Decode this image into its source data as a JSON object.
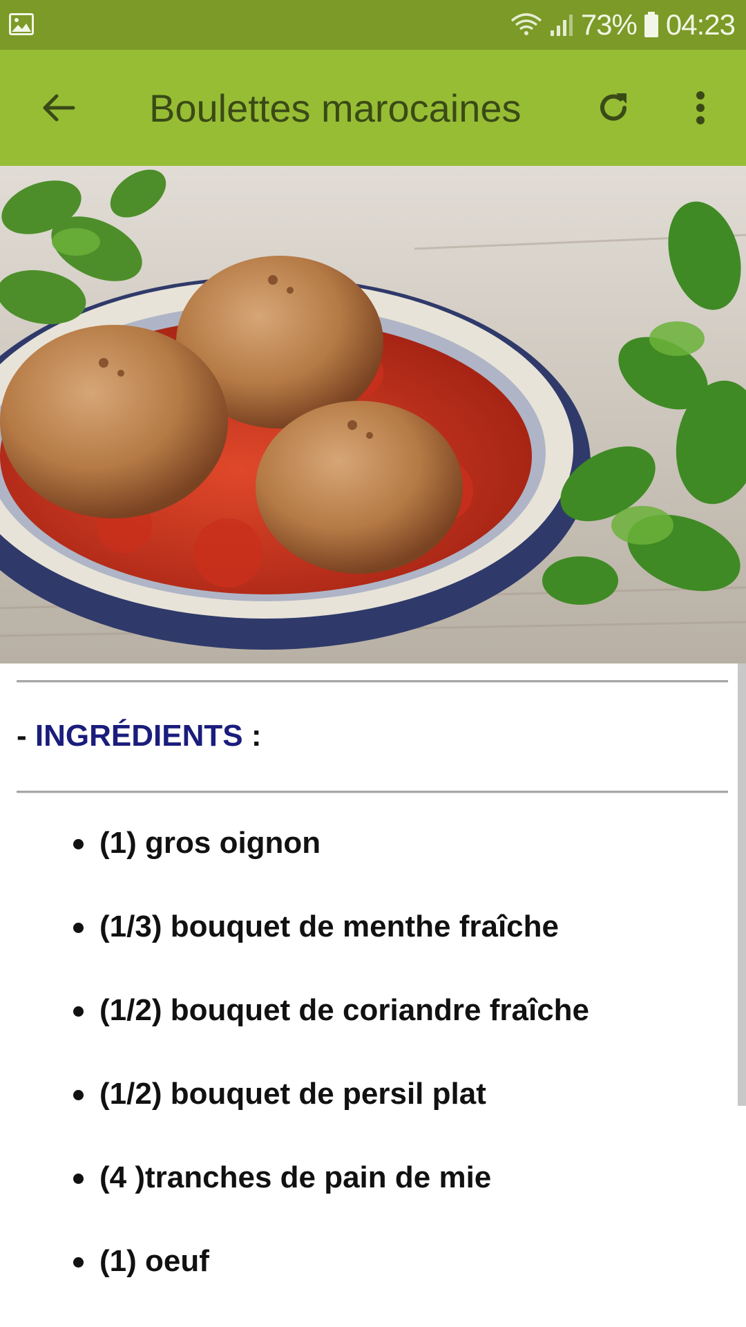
{
  "status_bar": {
    "battery_percent": "73%",
    "time": "04:23",
    "icons": [
      "gallery-icon",
      "wifi-icon",
      "signal-icon",
      "battery-icon"
    ]
  },
  "app_bar": {
    "title": "Boulettes marocaines",
    "icons": [
      "back-arrow-icon",
      "refresh-icon",
      "more-vert-icon"
    ]
  },
  "hero_image": {
    "subject": "meatballs-in-tomato-sauce-photo"
  },
  "section": {
    "prefix": "- ",
    "heading": "INGRÉDIENTS",
    "suffix": " :"
  },
  "ingredients": [
    "(1) gros oignon",
    "(1/3) bouquet de menthe fraîche",
    "(1/2) bouquet de coriandre fraîche",
    "(1/2) bouquet de persil plat",
    "(4 )tranches de pain de mie",
    "(1) oeuf"
  ],
  "colors": {
    "status_bar": "#7b9a27",
    "app_bar": "#97bd35",
    "app_bar_text": "#3a4a16",
    "heading_blue": "#1a1d7c"
  }
}
